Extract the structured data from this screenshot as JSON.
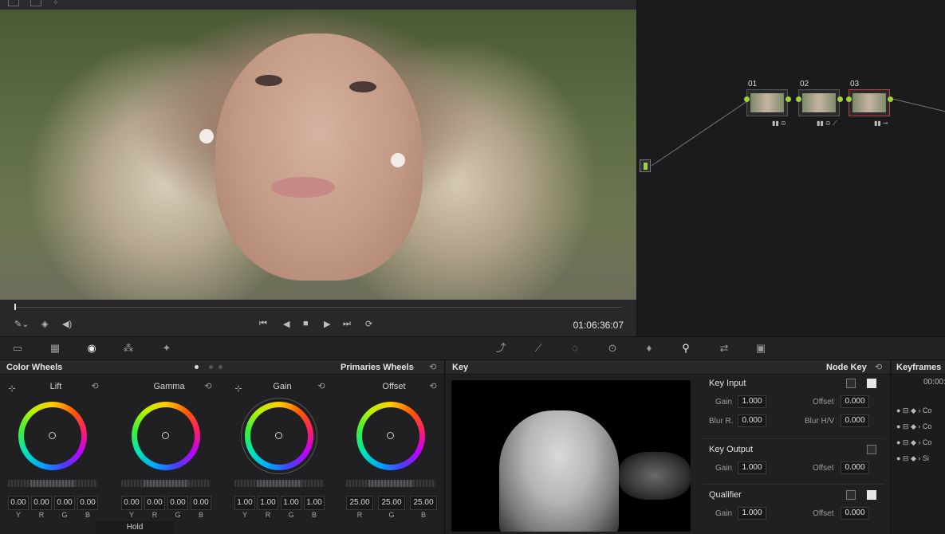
{
  "viewer": {
    "timecode": "01:06:36:07",
    "transport_icons": [
      "skip-to-start-icon",
      "step-back-icon",
      "stop-icon",
      "play-icon",
      "skip-to-end-icon",
      "loop-icon"
    ]
  },
  "node_graph": {
    "nodes": [
      {
        "label": "01",
        "indicators": "▮▮ ⊙"
      },
      {
        "label": "02",
        "indicators": "▮▮ ⊙ ⟋"
      },
      {
        "label": "03",
        "indicators": "▮▮ ⊸"
      }
    ]
  },
  "palette_bar": {
    "left_icons": [
      "camera-raw-icon",
      "color-match-icon",
      "color-wheels-icon",
      "rgb-mixer-icon",
      "motion-effects-icon"
    ],
    "right_icons": [
      "curves-icon",
      "qualifier-icon",
      "window-icon",
      "tracker-icon",
      "blur-icon",
      "key-icon",
      "sizing-icon",
      "3d-icon"
    ]
  },
  "wheels": {
    "title": "Color Wheels",
    "mode": "Primaries Wheels",
    "items": [
      {
        "label": "Lift",
        "values": [
          "0.00",
          "0.00",
          "0.00",
          "0.00"
        ],
        "channels": [
          "Y",
          "R",
          "G",
          "B"
        ]
      },
      {
        "label": "Gamma",
        "values": [
          "0.00",
          "0.00",
          "0.00",
          "0.00"
        ],
        "channels": [
          "Y",
          "R",
          "G",
          "B"
        ]
      },
      {
        "label": "Gain",
        "values": [
          "1.00",
          "1.00",
          "1.00",
          "1.00"
        ],
        "channels": [
          "Y",
          "R",
          "G",
          "B"
        ]
      },
      {
        "label": "Offset",
        "values": [
          "25.00",
          "25.00",
          "25.00"
        ],
        "channels": [
          "R",
          "G",
          "B"
        ]
      }
    ],
    "hold_label": "Hold"
  },
  "key": {
    "title": "Key",
    "mode": "Node Key",
    "key_input": {
      "title": "Key Input",
      "gain_label": "Gain",
      "gain": "1.000",
      "offset_label": "Offset",
      "offset": "0.000",
      "blur_r_label": "Blur R.",
      "blur_r": "0.000",
      "blur_hv_label": "Blur H/V",
      "blur_hv": "0.000"
    },
    "key_output": {
      "title": "Key Output",
      "gain_label": "Gain",
      "gain": "1.000",
      "offset_label": "Offset",
      "offset": "0.000"
    },
    "qualifier": {
      "title": "Qualifier",
      "gain_label": "Gain",
      "gain": "1.000",
      "offset_label": "Offset",
      "offset": "0.000"
    }
  },
  "keyframes": {
    "title": "Keyframes",
    "timecode": "00:00:",
    "rows": [
      "Co",
      "Co",
      "Co",
      "Si"
    ]
  }
}
